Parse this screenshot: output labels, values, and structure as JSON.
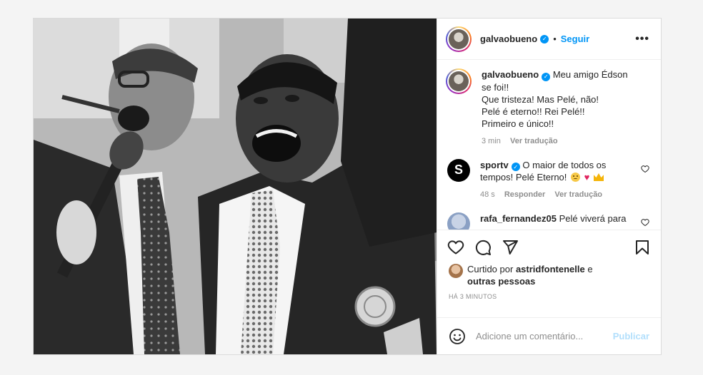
{
  "colors": {
    "accent": "#0095f6",
    "muted": "#8e8e8e",
    "publish_disabled": "#b2dffc",
    "heart_red": "#e0245e"
  },
  "header": {
    "username": "galvaobueno",
    "separator": "•",
    "follow_label": "Seguir",
    "more_icon": "more-horizontal-icon",
    "more_label": "•••"
  },
  "caption": {
    "username": "galvaobueno",
    "lines": [
      "Meu amigo Édson se foi!!",
      "Que tristeza! Mas Pelé, não!",
      "Pelé é eterno!! Rei Pelé!!",
      "Primeiro e único!!"
    ],
    "time": "3 min",
    "translate": "Ver tradução"
  },
  "comments": [
    {
      "username": "sportv",
      "avatar_letter": "S",
      "text": "O maior de todos os tempos! Pelé Eterno!",
      "emojis": [
        "sad-face-icon",
        "red-heart-icon",
        "crown-icon"
      ],
      "time": "48 s",
      "reply": "Responder",
      "translate": "Ver tradução"
    },
    {
      "username": "rafa_fernandez05",
      "text": "Pelé viverá para"
    }
  ],
  "actions": [
    "heart-icon",
    "comment-icon",
    "share-icon",
    "bookmark-icon"
  ],
  "likes": {
    "prefix": "Curtido por",
    "user": "astridfontenelle",
    "joiner": "e",
    "others": "outras pessoas"
  },
  "timestamp": "HÁ 3 MINUTOS",
  "add_comment": {
    "placeholder": "Adicione um comentário...",
    "publish_label": "Publicar",
    "emoji_icon": "smiley-icon"
  }
}
